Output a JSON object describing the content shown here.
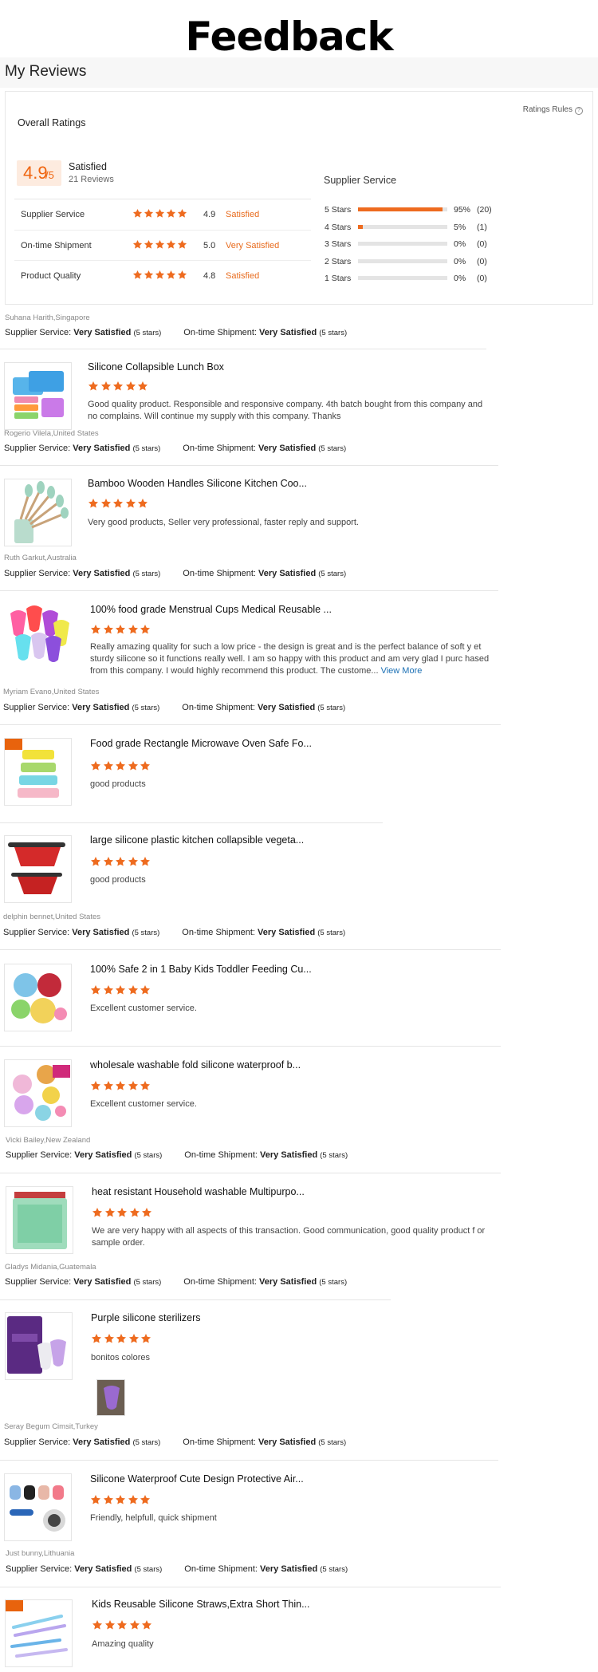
{
  "page": {
    "title": "Feedback",
    "section_title": "My Reviews"
  },
  "overall": {
    "title": "Overall Ratings",
    "rules_label": "Ratings Rules",
    "score": "4.9",
    "score_max": "/5",
    "label": "Satisfied",
    "reviews_count": "21 Reviews",
    "metrics": [
      {
        "name": "Supplier Service",
        "score": "4.9",
        "label": "Satisfied"
      },
      {
        "name": "On-time Shipment",
        "score": "5.0",
        "label": "Very Satisfied"
      },
      {
        "name": "Product Quality",
        "score": "4.8",
        "label": "Satisfied"
      }
    ],
    "distribution_title": "Supplier Service",
    "distribution": [
      {
        "label": "5 Stars",
        "percent": 95,
        "percent_text": "95%",
        "count": "(20)"
      },
      {
        "label": "4 Stars",
        "percent": 5,
        "percent_text": "5%",
        "count": "(1)"
      },
      {
        "label": "3 Stars",
        "percent": 0,
        "percent_text": "0%",
        "count": "(0)"
      },
      {
        "label": "2 Stars",
        "percent": 0,
        "percent_text": "0%",
        "count": "(0)"
      },
      {
        "label": "1 Stars",
        "percent": 0,
        "percent_text": "0%",
        "count": "(0)"
      }
    ]
  },
  "labels": {
    "supplier_service": "Supplier Service:",
    "ontime_shipment": "On-time Shipment:",
    "very_satisfied": "Very Satisfied",
    "five_stars": "(5 stars)",
    "view_more": "View More"
  },
  "reviewers": [
    "Suhana Harith,Singapore",
    "Rogerio Vilela,United States",
    "Ruth Garkut,Australia",
    "Myriam Evano,United States",
    "delphin bennet,United States",
    "Vicki Bailey,New Zealand",
    "Gladys Midania,Guatemala",
    "Seray Begum Cimsit,Turkey",
    "Just bunny,Lithuania"
  ],
  "products": [
    {
      "title": "Silicone Collapsible Lunch Box",
      "rating": 5,
      "text": "Good quality product. Responsible and responsive company. 4th batch bought from this company and no complains. Will continue my supply with this company. Thanks"
    },
    {
      "title": "Bamboo Wooden Handles Silicone Kitchen Coo...",
      "rating": 5,
      "text": "Very good products, Seller very professional, faster reply and support."
    },
    {
      "title": "100% food grade Menstrual Cups Medical Reusable ...",
      "rating": 5,
      "text": "Really amazing quality for such a low price - the design is great and is the perfect balance of soft y et sturdy silicone so it functions really well. I am so happy with this product and am very glad I purc hased from this company. I would highly recommend this product. The custome..."
    },
    {
      "title": "Food grade Rectangle Microwave Oven Safe Fo...",
      "rating": 5,
      "text": "good products"
    },
    {
      "title": "large silicone plastic kitchen collapsible vegeta...",
      "rating": 5,
      "text": "good products"
    },
    {
      "title": "100% Safe 2 in 1 Baby Kids Toddler Feeding Cu...",
      "rating": 5,
      "text": "Excellent customer service."
    },
    {
      "title": "wholesale washable fold silicone waterproof b...",
      "rating": 5,
      "text": "Excellent customer service."
    },
    {
      "title": "heat resistant Household washable Multipurpo...",
      "rating": 5,
      "text": "We are very happy with all aspects of this transaction. Good communication, good quality product f or sample order."
    },
    {
      "title": "Purple silicone sterilizers",
      "rating": 5,
      "text": "bonitos colores"
    },
    {
      "title": "Silicone Waterproof Cute Design Protective Air...",
      "rating": 5,
      "text": "Friendly, helpfull, quick shipment"
    },
    {
      "title": "Kids Reusable Silicone Straws,Extra Short Thin...",
      "rating": 5,
      "text": "Amazing quality"
    }
  ],
  "colors": {
    "accent": "#ee6b1f",
    "link": "#1a6fb4",
    "score_bg": "#fdebdf"
  }
}
